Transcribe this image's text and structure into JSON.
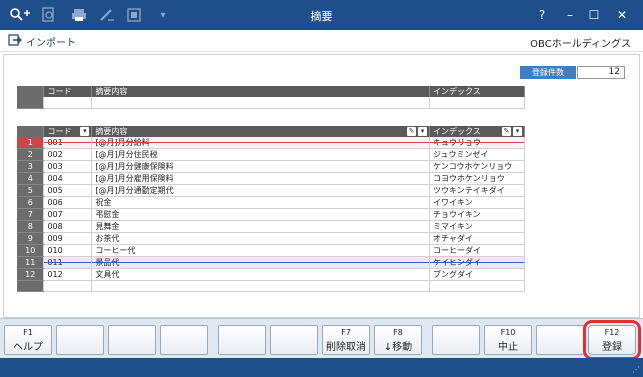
{
  "window": {
    "title": "摘要",
    "controls": {
      "help": "?",
      "minimize": "–",
      "maximize": "☐",
      "close": "✕"
    }
  },
  "toolbar": {
    "icons": [
      "search-plus-icon",
      "zoom-icon",
      "print-icon",
      "edit-icon",
      "export-icon",
      "dropdown-icon"
    ]
  },
  "menubar": {
    "import_label": "インポート",
    "company": "OBCホールディングス"
  },
  "count": {
    "label": "登録件数",
    "value": "12"
  },
  "entry_grid": {
    "headers": {
      "code": "コード",
      "desc": "摘要内容",
      "index": "インデックス"
    }
  },
  "list_grid": {
    "headers": {
      "code": "コード",
      "desc": "摘要内容",
      "index": "インデックス"
    },
    "rows": [
      {
        "n": "1",
        "code": "001",
        "desc": "[@月]月分給料",
        "index": "キュウリョウ"
      },
      {
        "n": "2",
        "code": "002",
        "desc": "[@月]月分住民税",
        "index": "ジュウミンゼイ"
      },
      {
        "n": "3",
        "code": "003",
        "desc": "[@月]月分健康保険料",
        "index": "ケンコウホケンリョウ"
      },
      {
        "n": "4",
        "code": "004",
        "desc": "[@月]月分雇用保険料",
        "index": "コヨウホケンリョウ"
      },
      {
        "n": "5",
        "code": "005",
        "desc": "[@月]月分通勤定期代",
        "index": "ツウキンテイキダイ"
      },
      {
        "n": "6",
        "code": "006",
        "desc": "祝金",
        "index": "イワイキン"
      },
      {
        "n": "7",
        "code": "007",
        "desc": "弔慰金",
        "index": "チョウイキン"
      },
      {
        "n": "8",
        "code": "008",
        "desc": "見舞金",
        "index": "ミマイキン"
      },
      {
        "n": "9",
        "code": "009",
        "desc": "お茶代",
        "index": "オチャダイ"
      },
      {
        "n": "10",
        "code": "010",
        "desc": "コーヒー代",
        "index": "コーヒーダイ"
      },
      {
        "n": "11",
        "code": "011",
        "desc": "景品代",
        "index": "ケイヒンダイ"
      },
      {
        "n": "12",
        "code": "012",
        "desc": "文具代",
        "index": "ブングダイ"
      }
    ]
  },
  "fkeys": [
    {
      "fn": "F1",
      "label": "ヘルプ"
    },
    {
      "fn": "",
      "label": ""
    },
    {
      "fn": "",
      "label": ""
    },
    {
      "fn": "",
      "label": ""
    },
    {
      "fn": "",
      "label": ""
    },
    {
      "fn": "",
      "label": ""
    },
    {
      "fn": "F7",
      "label": "削除取消"
    },
    {
      "fn": "F8",
      "label": "↓移動"
    },
    {
      "fn": "",
      "label": ""
    },
    {
      "fn": "F10",
      "label": "中止"
    },
    {
      "fn": "",
      "label": ""
    },
    {
      "fn": "F12",
      "label": "登録"
    }
  ],
  "colors": {
    "titlebar": "#1f4f8b",
    "header": "#5a5a5a",
    "count_label": "#3d7fc5",
    "selected_row": "#c8474f",
    "highlight": "#e03030"
  }
}
